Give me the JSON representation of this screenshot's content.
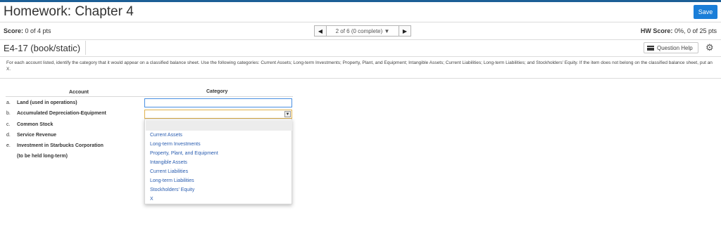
{
  "header": {
    "title": "Homework: Chapter 4",
    "save_label": "Save"
  },
  "score": {
    "label": "Score:",
    "value": "0 of 4 pts"
  },
  "pager": {
    "prev": "◀",
    "text": "2 of 6 (0 complete) ▼",
    "next": "▶"
  },
  "hw_score": {
    "label": "HW Score:",
    "value": "0%, 0 of 25 pts"
  },
  "question": {
    "id": "E4-17 (book/static)",
    "help_label": "Question Help",
    "gear": "⚙"
  },
  "instructions": "For each account listed, identify the category that it would appear on a classified balance sheet. Use the following categories: Current Assets; Long-term Investments; Property, Plant, and Equipment; Intangible Assets; Current Liabilities; Long-term Liabilities; and Stockholders' Equity. If the item does not belong on the classified balance sheet, put an X.",
  "table": {
    "col_account": "Account",
    "col_category": "Category",
    "rows": [
      {
        "letter": "a.",
        "account": "Land (used in operations)"
      },
      {
        "letter": "b.",
        "account": "Accumulated Depreciation-Equipment"
      },
      {
        "letter": "c.",
        "account": "Common Stock"
      },
      {
        "letter": "d.",
        "account": "Service Revenue"
      },
      {
        "letter": "e.",
        "account": "Investment in Starbucks Corporation"
      }
    ],
    "row_e_sub": "(to be held long-term)"
  },
  "dropdown": {
    "arrow": "▼",
    "options": [
      "Current Assets",
      "Long-term Investments",
      "Property, Plant, and Equipment",
      "Intangible Assets",
      "Current Liabilities",
      "Long-term Liabilities",
      "Stockholders' Equity",
      "X"
    ]
  }
}
